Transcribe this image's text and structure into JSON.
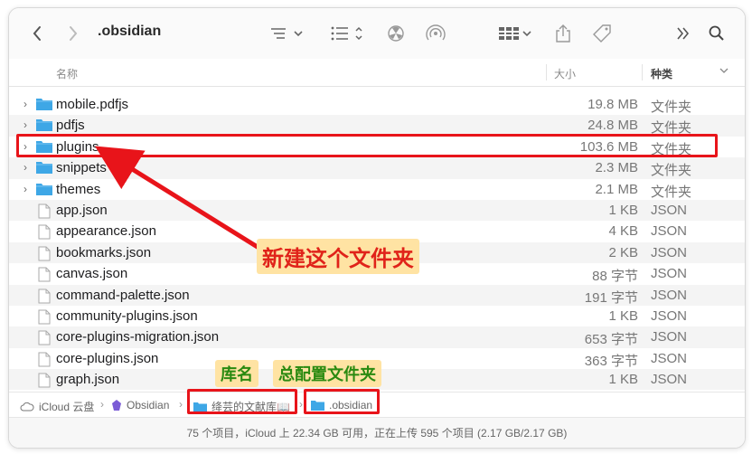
{
  "toolbar": {
    "title": ".obsidian",
    "back_icon": "chevron-left-icon",
    "forward_icon": "chevron-right-icon"
  },
  "columns": {
    "name": "名称",
    "size": "大小",
    "kind": "种类"
  },
  "rows": [
    {
      "name": "mobile.pdfjs",
      "size": "19.8 MB",
      "kind": "文件夹",
      "folder": true
    },
    {
      "name": "pdfjs",
      "size": "24.8 MB",
      "kind": "文件夹",
      "folder": true
    },
    {
      "name": "plugins",
      "size": "103.6 MB",
      "kind": "文件夹",
      "folder": true
    },
    {
      "name": "snippets",
      "size": "2.3 MB",
      "kind": "文件夹",
      "folder": true
    },
    {
      "name": "themes",
      "size": "2.1 MB",
      "kind": "文件夹",
      "folder": true
    },
    {
      "name": "app.json",
      "size": "1 KB",
      "kind": "JSON",
      "folder": false
    },
    {
      "name": "appearance.json",
      "size": "4 KB",
      "kind": "JSON",
      "folder": false
    },
    {
      "name": "bookmarks.json",
      "size": "2 KB",
      "kind": "JSON",
      "folder": false
    },
    {
      "name": "canvas.json",
      "size": "88 字节",
      "kind": "JSON",
      "folder": false
    },
    {
      "name": "command-palette.json",
      "size": "191 字节",
      "kind": "JSON",
      "folder": false
    },
    {
      "name": "community-plugins.json",
      "size": "1 KB",
      "kind": "JSON",
      "folder": false
    },
    {
      "name": "core-plugins-migration.json",
      "size": "653 字节",
      "kind": "JSON",
      "folder": false
    },
    {
      "name": "core-plugins.json",
      "size": "363 字节",
      "kind": "JSON",
      "folder": false
    },
    {
      "name": "graph.json",
      "size": "1 KB",
      "kind": "JSON",
      "folder": false
    }
  ],
  "pathbar": {
    "icloud": "iCloud 云盘",
    "obsidian": "Obsidian",
    "vault": "绛芸的文献库📖",
    "current": ".obsidian"
  },
  "status": "75 个项目，iCloud 上 22.34 GB 可用，正在上传 595 个项目 (2.17 GB/2.17 GB)",
  "annotations": {
    "create_folder": "新建这个文件夹",
    "vault_name": "库名",
    "config_folder": "总配置文件夹"
  },
  "colors": {
    "folder": "#3ea7e6",
    "annotation_red": "#e8141a",
    "note_bg": "#ffe3a3"
  }
}
